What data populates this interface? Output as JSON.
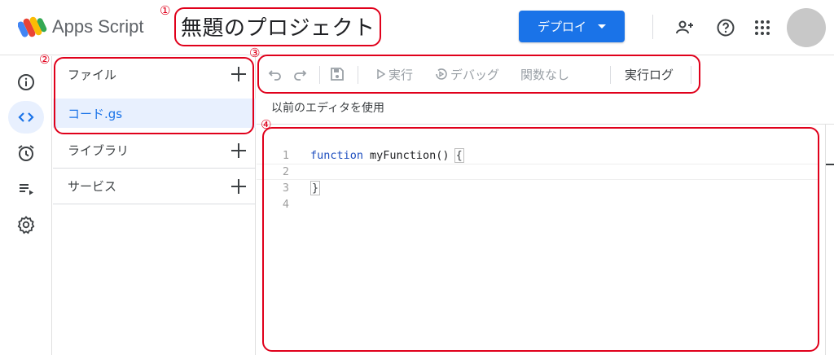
{
  "header": {
    "app_name": "Apps Script",
    "project_title": "無題のプロジェクト",
    "deploy_label": "デプロイ",
    "icons": [
      "add-person-icon",
      "help-icon",
      "apps-grid-icon"
    ]
  },
  "rail": {
    "items": [
      "info-icon",
      "code-icon",
      "alarm-icon",
      "executions-icon",
      "settings-icon"
    ],
    "active": "code-icon"
  },
  "files_panel": {
    "files_label": "ファイル",
    "file_name": "コード.gs",
    "libraries_label": "ライブラリ",
    "services_label": "サービス"
  },
  "toolbar": {
    "run_label": "実行",
    "debug_label": "デバッグ",
    "function_label": "関数なし",
    "log_label": "実行ログ"
  },
  "legacy_editor_label": "以前のエディタを使用",
  "editor": {
    "line_numbers": [
      "1",
      "2",
      "3",
      "4"
    ],
    "code_keyword": "function",
    "code_rest": "myFunction()",
    "open_brace": "{",
    "close_brace": "}"
  },
  "annotations": {
    "n1": "①",
    "n2": "②",
    "n3": "③",
    "n4": "④"
  },
  "colors": {
    "accent": "#1a73e8",
    "annotation": "#e0001b",
    "selected_bg": "#e8f0fe"
  }
}
